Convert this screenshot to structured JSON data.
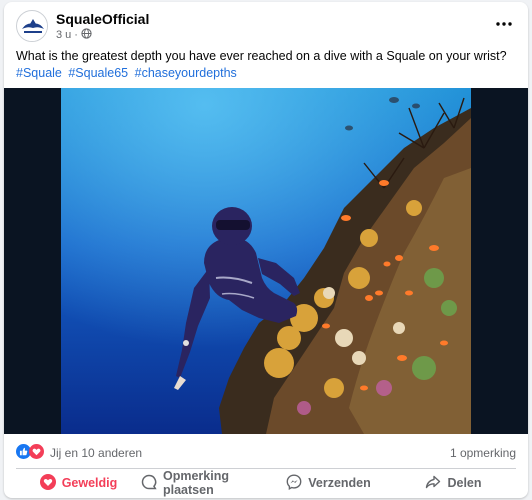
{
  "post": {
    "page_name": "SqualeOfficial",
    "time": "3 u",
    "text": "What is the greatest depth you have ever reached on a dive with a Squale on your wrist?",
    "hashtags": [
      "#Squale",
      "#Squale65",
      "#chaseyourdepths"
    ]
  },
  "engagement": {
    "reactions_text": "Jij en 10 anderen",
    "comments_text": "1 opmerking"
  },
  "actions": {
    "like": "Geweldig",
    "comment": "Opmerking plaatsen",
    "send": "Verzenden",
    "share": "Delen"
  },
  "colors": {
    "link": "#216fdb",
    "love": "#f33e58",
    "like": "#1877f2",
    "muted": "#65676b"
  },
  "icons": {
    "globe": "globe-icon",
    "more": "more-options-icon",
    "like_reaction": "like-reaction-icon",
    "love_reaction": "love-reaction-icon"
  }
}
